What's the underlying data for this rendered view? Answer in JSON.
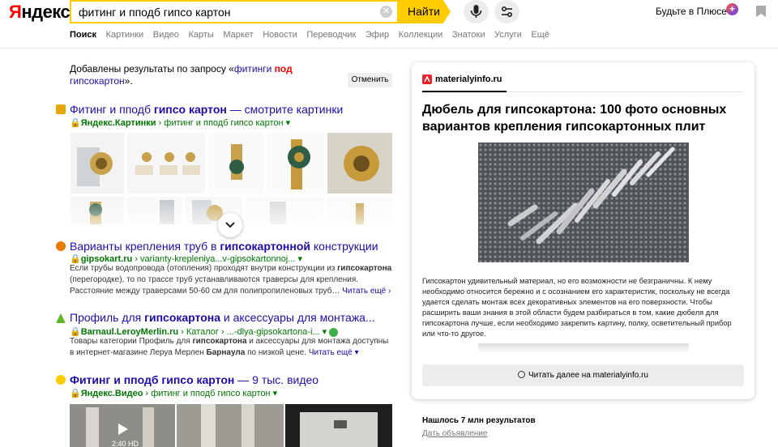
{
  "header": {
    "logo_first": "Я",
    "logo_rest": "ндекс",
    "search_value": "фитинг и пподб гипсо картон",
    "clear_glyph": "✕",
    "find_label": "Найти",
    "plus_label": "Будьте в Плюсе",
    "plus_badge": "+"
  },
  "tabs": [
    "Поиск",
    "Картинки",
    "Видео",
    "Карты",
    "Маркет",
    "Новости",
    "Переводчик",
    "Эфир",
    "Коллекции",
    "Знатоки",
    "Услуги",
    "Ещё"
  ],
  "notice": {
    "prefix": "Добавлены результаты по запросу «",
    "word1": "фитинги",
    "word2": "под",
    "word3": "гипсокартон",
    "suffix": "».",
    "cancel_label": "Отменить"
  },
  "results": {
    "images": {
      "title_plain": "Фитинг и пподб ",
      "title_bold": "гипсо картон",
      "title_tail": " — смотрите картинки",
      "url_host": "Яндекс.Картинки",
      "url_path": " › фитинг и пподб гипсо картон ▾"
    },
    "gipsokart": {
      "title_plain": "Варианты крепления труб в ",
      "title_bold": "гипсокартонной",
      "title_tail": " конструкции",
      "url_host": "gipsokart.ru",
      "url_path": " › varianty-krepleniya...v-gipsokartonnoj... ▾",
      "snippet1": "Если трубы водопровода (отопления) проходят внутри конструкции из ",
      "snippet_bold": "гипсокартона",
      "snippet2": " (перегородке), то по трассе труб устанавливаются траверсы для крепления. Расстояние между траверсами 50-60 см для полипропиленовых труб… ",
      "more": "Читать ещё ›"
    },
    "leroy": {
      "title_plain": "Профиль для ",
      "title_bold": "гипсокартона",
      "title_tail": " и аксессуары для монтажа...",
      "url_host": "Barnaul.LeroyMerlin.ru",
      "url_path": " › Каталог › ...-dlya-gipsokartona-i... ▾",
      "snippet1": "Товары категории Профиль для ",
      "snippet_bold": "гипсокартона",
      "snippet2": " и аксессуары для монтажа доступны в интернет-магазине Леруа Мерлен ",
      "snippet_bold2": "Барнаула",
      "snippet3": " по низкой цене. ",
      "more": "Читать ещё ▾"
    },
    "video": {
      "title_bold": "Фитинг и пподб гипсо картон",
      "title_tail": " — 9 тыс. видео",
      "url_host": "Яндекс.Видео",
      "url_path": " › фитинг и пподб гипсо картон ▾",
      "duration": "2:40 HD"
    }
  },
  "card": {
    "source": "materialyinfo.ru",
    "title": "Дюбель для гипсокартона: 100 фото основных вариантов крепления гипсокартонных плит",
    "text": "Гипсокартон удивительный материал, но его возможности не безграничны. К нему необходимо относится бережно и с осознанием его характеристик, поскольку не всегда удается сделать монтаж всех декоративных элементов на его поверхности. Чтобы расширить ваши знания в этой области будем разбираться в том, какие дюбеля для гипсокартона лучше, если необходимо закрепить картину, полку, осветительный прибор или что-то другое.",
    "read_more": "Читать далее на materialyinfo.ru"
  },
  "footer": {
    "found": "Нашлось 7 млн результатов",
    "ad": "Дать объявление"
  },
  "colors": {
    "accent": "#ffcc00",
    "link": "#1a0dab",
    "url": "#007700",
    "brand_red": "#ff0000"
  }
}
